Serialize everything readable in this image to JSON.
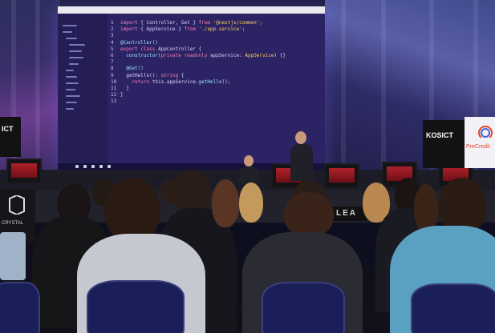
{
  "screen": {
    "line_numbers": [
      "1",
      "2",
      "3",
      "4",
      "5",
      "6",
      "7",
      "8",
      "9",
      "10",
      "11",
      "12",
      "13"
    ],
    "code_lines": [
      {
        "parts": [
          {
            "t": "import",
            "c": "kw"
          },
          {
            "t": " { Controller, Get } ",
            "c": ""
          },
          {
            "t": "from",
            "c": "kw"
          },
          {
            "t": " '@nestjs/common';",
            "c": "str"
          }
        ]
      },
      {
        "parts": [
          {
            "t": "import",
            "c": "kw"
          },
          {
            "t": " { AppService } ",
            "c": ""
          },
          {
            "t": "from",
            "c": "kw"
          },
          {
            "t": " './app.service';",
            "c": "str"
          }
        ]
      },
      {
        "parts": []
      },
      {
        "parts": [
          {
            "t": "@Controller()",
            "c": "fn"
          }
        ]
      },
      {
        "parts": [
          {
            "t": "export class",
            "c": "kw"
          },
          {
            "t": " AppController {",
            "c": ""
          }
        ]
      },
      {
        "parts": [
          {
            "t": "  constructor",
            "c": "fn"
          },
          {
            "t": "(",
            "c": ""
          },
          {
            "t": "private readonly",
            "c": "kw"
          },
          {
            "t": " appService: ",
            "c": ""
          },
          {
            "t": "AppService",
            "c": "str"
          },
          {
            "t": ") {}",
            "c": ""
          }
        ]
      },
      {
        "parts": []
      },
      {
        "parts": [
          {
            "t": "  @Get()",
            "c": "fn"
          }
        ]
      },
      {
        "parts": [
          {
            "t": "  getHello(): ",
            "c": ""
          },
          {
            "t": "string",
            "c": "kw"
          },
          {
            "t": " {",
            "c": ""
          }
        ]
      },
      {
        "parts": [
          {
            "t": "    return",
            "c": "kw"
          },
          {
            "t": " this.appService.",
            "c": ""
          },
          {
            "t": "getHello",
            "c": "fn"
          },
          {
            "t": "();",
            "c": ""
          }
        ]
      },
      {
        "parts": [
          {
            "t": "  }",
            "c": ""
          }
        ]
      },
      {
        "parts": [
          {
            "t": "}",
            "c": ""
          }
        ]
      },
      {
        "parts": []
      }
    ]
  },
  "sponsors": {
    "kosict": "KOSICT",
    "credit": "PreCredit",
    "ict_left": "ICT",
    "lea": "LEA",
    "crystal": "CRYSTAL"
  },
  "colors": {
    "screen_bg": "#2b2363",
    "keyword": "#ff7eb6",
    "string": "#ffcf5a",
    "accent": "#e8422a"
  }
}
